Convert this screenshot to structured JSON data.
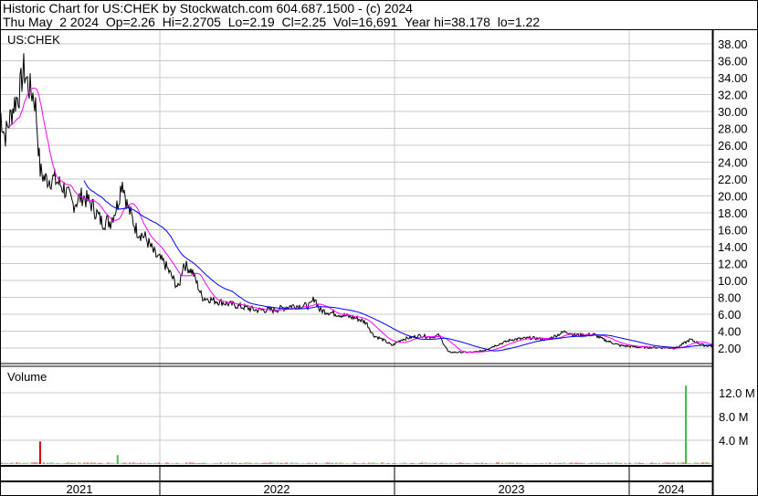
{
  "header": {
    "title": "Historic Chart for US:CHEK by Stockwatch.com 604.687.1500 - (c) 2024",
    "quote": "Thu May  2 2024  Op=2.26  Hi=2.2705  Lo=2.19  Cl=2.25  Vol=16,691  Year hi=38.178  lo=1.22"
  },
  "chart_data": [
    {
      "type": "line",
      "title": "US:CHEK",
      "ylim": [
        0,
        39
      ],
      "yticks": [
        "38.00",
        "36.00",
        "34.00",
        "32.00",
        "30.00",
        "28.00",
        "26.00",
        "24.00",
        "22.00",
        "20.00",
        "18.00",
        "16.00",
        "14.00",
        "12.00",
        "10.00",
        "8.00",
        "6.00",
        "4.00",
        "2.00"
      ],
      "xticks": [
        "2021",
        "2022",
        "2023",
        "2024"
      ],
      "grid": true,
      "series": [
        {
          "name": "Price",
          "color": "#000000",
          "x": [
            2021.32,
            2021.34,
            2021.36,
            2021.38,
            2021.4,
            2021.42,
            2021.44,
            2021.46,
            2021.47,
            2021.49,
            2021.51,
            2021.55,
            2021.59,
            2021.63,
            2021.67,
            2021.71,
            2021.75,
            2021.79,
            2021.82,
            2021.84,
            2021.86,
            2021.9,
            2021.94,
            2021.98,
            2022.02,
            2022.06,
            2022.08,
            2022.1,
            2022.14,
            2022.18,
            2022.25,
            2022.33,
            2022.41,
            2022.49,
            2022.56,
            2022.64,
            2022.66,
            2022.68,
            2022.76,
            2022.84,
            2022.88,
            2022.91,
            2022.95,
            2022.99,
            2023.03,
            2023.11,
            2023.15,
            2023.19,
            2023.23,
            2023.34,
            2023.38,
            2023.42,
            2023.5,
            2023.58,
            2023.65,
            2023.73,
            2023.77,
            2023.85,
            2023.89,
            2023.96,
            2024.04,
            2024.2,
            2024.26,
            2024.32,
            2024.35
          ],
          "y": [
            30,
            27,
            29,
            31,
            32,
            35,
            33,
            32,
            31,
            23,
            22,
            22,
            21,
            19,
            20,
            19,
            17,
            17,
            19,
            22,
            19,
            16,
            15,
            13,
            12,
            10,
            9,
            12,
            11,
            8,
            7.5,
            7,
            6.5,
            6.5,
            7,
            7,
            8,
            6.5,
            6,
            5.5,
            5,
            3.5,
            3,
            2.3,
            3,
            3.5,
            3.3,
            3.5,
            1.5,
            1.5,
            1.7,
            2.2,
            3.0,
            3.2,
            3.0,
            4,
            3.5,
            3.6,
            3.0,
            2.3,
            2.1,
            2.0,
            3,
            2.3,
            2.25
          ]
        },
        {
          "name": "Short MA",
          "color": "#ff00ff"
        },
        {
          "name": "Long MA",
          "color": "#0000ff"
        }
      ]
    },
    {
      "type": "bar",
      "title": "Volume",
      "yticks": [
        "12.0 M",
        "8.0 M",
        "4.0 M"
      ],
      "spikes": {
        "x": [
          2021.49,
          2021.82,
          2024.3
        ],
        "y": [
          3.8,
          1.5,
          13.2
        ]
      },
      "units": "M"
    }
  ]
}
